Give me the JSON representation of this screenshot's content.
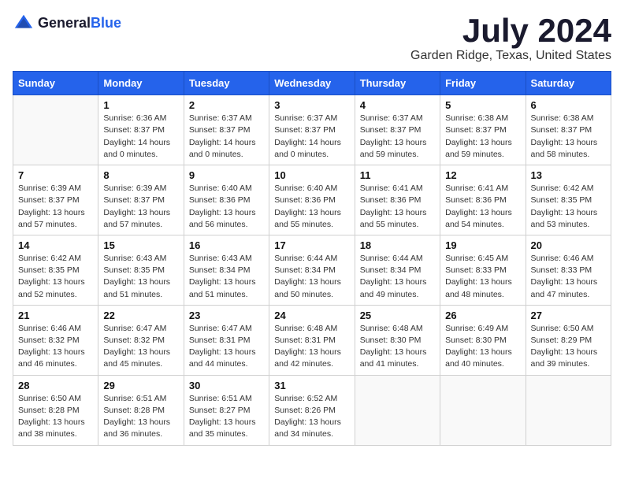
{
  "header": {
    "logo_general": "General",
    "logo_blue": "Blue",
    "title": "July 2024",
    "subtitle": "Garden Ridge, Texas, United States"
  },
  "calendar": {
    "days_of_week": [
      "Sunday",
      "Monday",
      "Tuesday",
      "Wednesday",
      "Thursday",
      "Friday",
      "Saturday"
    ],
    "weeks": [
      [
        {
          "day": "",
          "content": ""
        },
        {
          "day": "1",
          "content": "Sunrise: 6:36 AM\nSunset: 8:37 PM\nDaylight: 14 hours\nand 0 minutes."
        },
        {
          "day": "2",
          "content": "Sunrise: 6:37 AM\nSunset: 8:37 PM\nDaylight: 14 hours\nand 0 minutes."
        },
        {
          "day": "3",
          "content": "Sunrise: 6:37 AM\nSunset: 8:37 PM\nDaylight: 14 hours\nand 0 minutes."
        },
        {
          "day": "4",
          "content": "Sunrise: 6:37 AM\nSunset: 8:37 PM\nDaylight: 13 hours\nand 59 minutes."
        },
        {
          "day": "5",
          "content": "Sunrise: 6:38 AM\nSunset: 8:37 PM\nDaylight: 13 hours\nand 59 minutes."
        },
        {
          "day": "6",
          "content": "Sunrise: 6:38 AM\nSunset: 8:37 PM\nDaylight: 13 hours\nand 58 minutes."
        }
      ],
      [
        {
          "day": "7",
          "content": "Sunrise: 6:39 AM\nSunset: 8:37 PM\nDaylight: 13 hours\nand 57 minutes."
        },
        {
          "day": "8",
          "content": "Sunrise: 6:39 AM\nSunset: 8:37 PM\nDaylight: 13 hours\nand 57 minutes."
        },
        {
          "day": "9",
          "content": "Sunrise: 6:40 AM\nSunset: 8:36 PM\nDaylight: 13 hours\nand 56 minutes."
        },
        {
          "day": "10",
          "content": "Sunrise: 6:40 AM\nSunset: 8:36 PM\nDaylight: 13 hours\nand 55 minutes."
        },
        {
          "day": "11",
          "content": "Sunrise: 6:41 AM\nSunset: 8:36 PM\nDaylight: 13 hours\nand 55 minutes."
        },
        {
          "day": "12",
          "content": "Sunrise: 6:41 AM\nSunset: 8:36 PM\nDaylight: 13 hours\nand 54 minutes."
        },
        {
          "day": "13",
          "content": "Sunrise: 6:42 AM\nSunset: 8:35 PM\nDaylight: 13 hours\nand 53 minutes."
        }
      ],
      [
        {
          "day": "14",
          "content": "Sunrise: 6:42 AM\nSunset: 8:35 PM\nDaylight: 13 hours\nand 52 minutes."
        },
        {
          "day": "15",
          "content": "Sunrise: 6:43 AM\nSunset: 8:35 PM\nDaylight: 13 hours\nand 51 minutes."
        },
        {
          "day": "16",
          "content": "Sunrise: 6:43 AM\nSunset: 8:34 PM\nDaylight: 13 hours\nand 51 minutes."
        },
        {
          "day": "17",
          "content": "Sunrise: 6:44 AM\nSunset: 8:34 PM\nDaylight: 13 hours\nand 50 minutes."
        },
        {
          "day": "18",
          "content": "Sunrise: 6:44 AM\nSunset: 8:34 PM\nDaylight: 13 hours\nand 49 minutes."
        },
        {
          "day": "19",
          "content": "Sunrise: 6:45 AM\nSunset: 8:33 PM\nDaylight: 13 hours\nand 48 minutes."
        },
        {
          "day": "20",
          "content": "Sunrise: 6:46 AM\nSunset: 8:33 PM\nDaylight: 13 hours\nand 47 minutes."
        }
      ],
      [
        {
          "day": "21",
          "content": "Sunrise: 6:46 AM\nSunset: 8:32 PM\nDaylight: 13 hours\nand 46 minutes."
        },
        {
          "day": "22",
          "content": "Sunrise: 6:47 AM\nSunset: 8:32 PM\nDaylight: 13 hours\nand 45 minutes."
        },
        {
          "day": "23",
          "content": "Sunrise: 6:47 AM\nSunset: 8:31 PM\nDaylight: 13 hours\nand 44 minutes."
        },
        {
          "day": "24",
          "content": "Sunrise: 6:48 AM\nSunset: 8:31 PM\nDaylight: 13 hours\nand 42 minutes."
        },
        {
          "day": "25",
          "content": "Sunrise: 6:48 AM\nSunset: 8:30 PM\nDaylight: 13 hours\nand 41 minutes."
        },
        {
          "day": "26",
          "content": "Sunrise: 6:49 AM\nSunset: 8:30 PM\nDaylight: 13 hours\nand 40 minutes."
        },
        {
          "day": "27",
          "content": "Sunrise: 6:50 AM\nSunset: 8:29 PM\nDaylight: 13 hours\nand 39 minutes."
        }
      ],
      [
        {
          "day": "28",
          "content": "Sunrise: 6:50 AM\nSunset: 8:28 PM\nDaylight: 13 hours\nand 38 minutes."
        },
        {
          "day": "29",
          "content": "Sunrise: 6:51 AM\nSunset: 8:28 PM\nDaylight: 13 hours\nand 36 minutes."
        },
        {
          "day": "30",
          "content": "Sunrise: 6:51 AM\nSunset: 8:27 PM\nDaylight: 13 hours\nand 35 minutes."
        },
        {
          "day": "31",
          "content": "Sunrise: 6:52 AM\nSunset: 8:26 PM\nDaylight: 13 hours\nand 34 minutes."
        },
        {
          "day": "",
          "content": ""
        },
        {
          "day": "",
          "content": ""
        },
        {
          "day": "",
          "content": ""
        }
      ]
    ]
  }
}
